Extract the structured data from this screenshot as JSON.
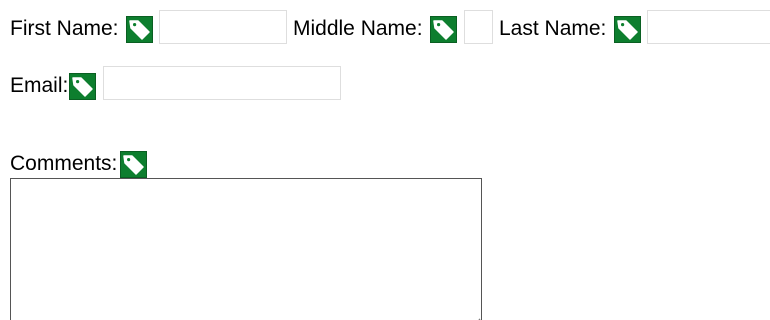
{
  "form": {
    "first_name": {
      "label": "First Name:",
      "value": "",
      "icon": "tag-icon"
    },
    "middle_name": {
      "label": "Middle Name:",
      "value": "",
      "icon": "tag-icon"
    },
    "last_name": {
      "label": "Last Name:",
      "value": "",
      "icon": "tag-icon"
    },
    "email": {
      "label": "Email:",
      "value": "",
      "icon": "tag-icon"
    },
    "comments": {
      "label": "Comments:",
      "value": "",
      "icon": "tag-icon"
    }
  },
  "colors": {
    "tag_background": "#0d7e2e",
    "tag_glyph": "#ffffff",
    "field_border": "#dedede",
    "textarea_border": "#555555"
  }
}
